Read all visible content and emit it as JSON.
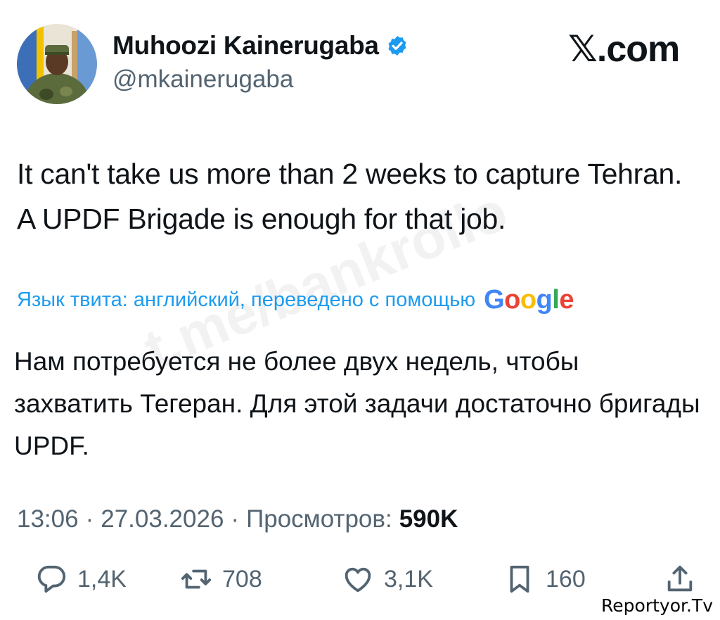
{
  "header": {
    "author_name": "Muhoozi Kainerugaba",
    "handle": "@mkainerugaba",
    "site_logo": "𝕏.com",
    "verified_icon": "verified-badge-icon"
  },
  "tweet": {
    "text": "It can't take us more than 2 weeks to capture Tehran. A UPDF Brigade is enough for that job.",
    "translation_note": "Язык твита: английский, переведено с помощью",
    "translation_provider": "Google",
    "translated_text": "Нам потребуется не более двух недель, чтобы захватить Тегеран. Для этой задачи достаточно бригады UPDF."
  },
  "meta": {
    "time": "13:06",
    "separator": "·",
    "date": "27.03.2026",
    "views_label": "Просмотров:",
    "views_count": "590K"
  },
  "actions": {
    "replies": "1,4K",
    "reposts": "708",
    "likes": "3,1K",
    "bookmarks": "160"
  },
  "watermark": "t.me/bankrollo",
  "corner_label": "Reportyor.Tv",
  "colors": {
    "link_blue": "#1d9bf0",
    "text_primary": "#0f1419",
    "text_secondary": "#536471"
  }
}
